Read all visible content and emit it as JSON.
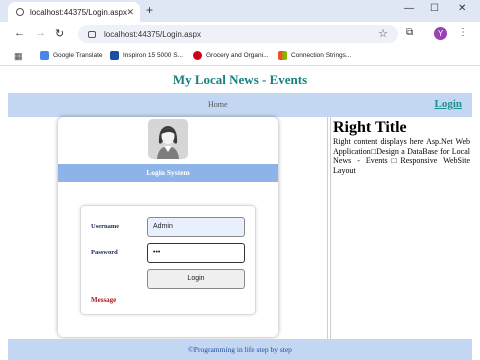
{
  "browser": {
    "tab_title": "localhost:44375/Login.aspx",
    "url": "localhost:44375/Login.aspx",
    "profile_initial": "Y",
    "bookmarks": [
      {
        "label": "Google Translate",
        "color": "#4a86e8"
      },
      {
        "label": "Inspiron 15 5000  S...",
        "color": "#1a4fa3"
      },
      {
        "label": "Grocery and Organi...",
        "color": "#d0021b"
      },
      {
        "label": "Connection Strings...",
        "color": "#f4b400"
      }
    ]
  },
  "site": {
    "title": "My Local News - Events",
    "nav_home": "Home",
    "nav_login": "Login",
    "footer": "©Programming in life step by step",
    "accent": "#158080",
    "nav_bg": "#c4d7f2"
  },
  "login": {
    "header": "Login System",
    "username_label": "Username",
    "username_value": "Admin",
    "password_label": "Password",
    "password_value": "•••",
    "button": "Login",
    "message": "Message"
  },
  "right": {
    "title": "Right Title",
    "content": "Right content displays here Asp.Net Web Application□Design a DataBase for Local News - Events□Responsive WebSite Layout"
  }
}
